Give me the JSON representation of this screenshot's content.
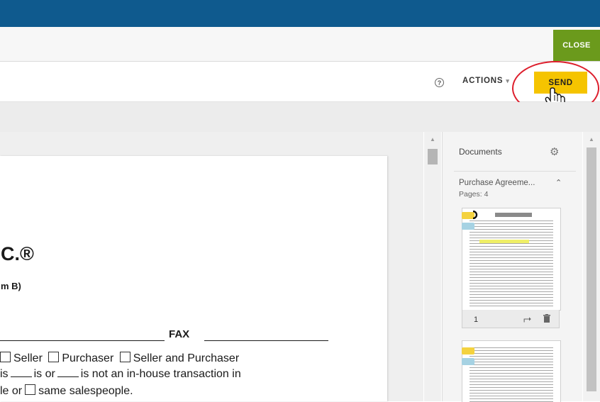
{
  "header": {
    "close_label": "CLOSE"
  },
  "toolbar": {
    "help_icon": "question-circle-icon",
    "actions_label": "ACTIONS",
    "actions_caret": "▾",
    "send_label": "SEND"
  },
  "document": {
    "title": "C.®",
    "subtitle": "m B)",
    "fax_label": "FAX",
    "line1": {
      "seller": "Seller",
      "purchaser": "Purchaser",
      "seller_and_purchaser": "Seller and Purchaser"
    },
    "line2": {
      "prefix": "is",
      "is_or": "is or",
      "rest": "is not an in-house transaction in"
    },
    "line3": {
      "prefix": "le or",
      "rest": "same salespeople."
    }
  },
  "sidebar": {
    "header": "Documents",
    "gear_icon": "gear-icon",
    "document_name": "Purchase Agreeme...",
    "pages_label": "Pages: 4",
    "thumbnails": [
      {
        "page_number": "1"
      },
      {
        "page_number": ""
      }
    ]
  },
  "colors": {
    "topbar": "#0f5a8e",
    "close": "#6b9a1c",
    "send": "#f5c400",
    "annotation_circle": "#dd1e2c"
  }
}
